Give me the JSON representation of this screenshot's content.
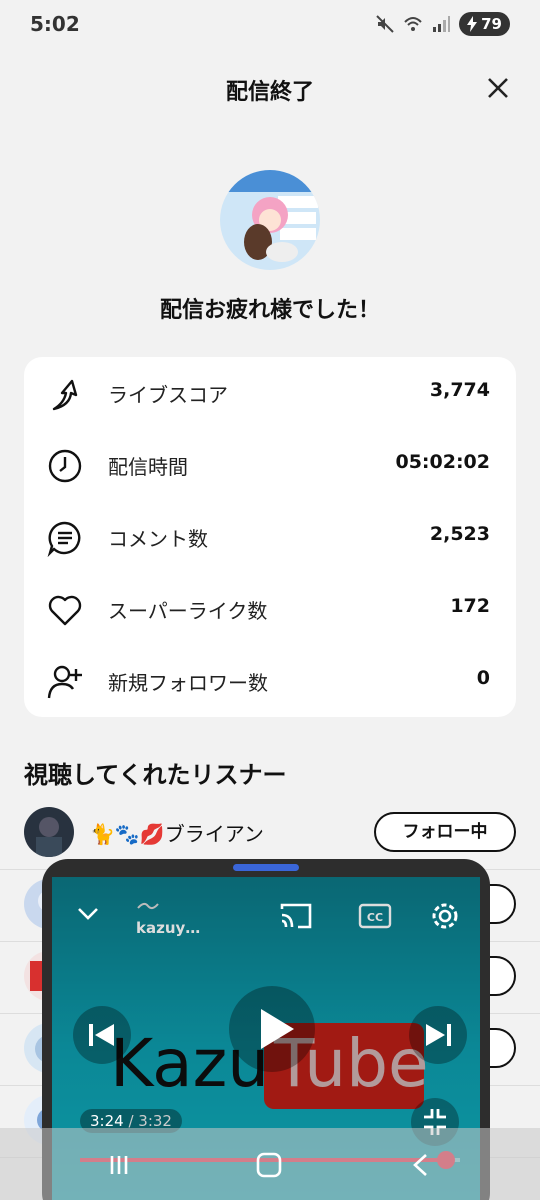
{
  "status_bar": {
    "time": "5:02",
    "battery": "79"
  },
  "header": {
    "title": "配信終了"
  },
  "summary": {
    "message": "配信お疲れ様でした！"
  },
  "stats": [
    {
      "icon": "trend-arrow-icon",
      "label": "ライブスコア",
      "value": "3,774"
    },
    {
      "icon": "clock-icon",
      "label": "配信時間",
      "value": "05:02:02"
    },
    {
      "icon": "comment-icon",
      "label": "コメント数",
      "value": "2,523"
    },
    {
      "icon": "heart-icon",
      "label": "スーパーライク数",
      "value": "172"
    },
    {
      "icon": "add-person-icon",
      "label": "新規フォロワー数",
      "value": "0"
    }
  ],
  "listeners": {
    "title": "視聴してくれたリスナー",
    "items": [
      {
        "name": "🐈🐾💋ブライアン",
        "button": "フォロー中"
      }
    ]
  },
  "pip_player": {
    "channel": "kazuy…",
    "current_time": "3:24",
    "duration": "3:32",
    "progress": 0.962,
    "logo_left": "Kazu",
    "logo_right": "Tube"
  },
  "colors": {
    "accent": "#e0243f",
    "handle": "#3a66d9",
    "card": "#ffffff",
    "background": "#f2f2f2"
  }
}
